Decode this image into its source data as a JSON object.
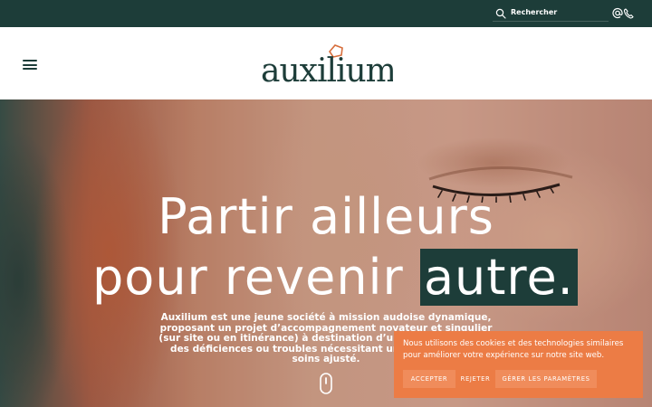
{
  "topbar": {
    "search_label": "Rechercher",
    "icons": [
      "search-icon",
      "at-icon",
      "phone-icon"
    ]
  },
  "header": {
    "logo_text": "auxilium",
    "icons": [
      "menu-icon"
    ]
  },
  "hero": {
    "headline_line1": "Partir ailleurs",
    "headline_line2_prefix": "pour revenir",
    "headline_line2_highlight": "autre.",
    "intro": "Auxilium est une jeune société à mission audoise dynamique, proposant un projet d’accompagnement novateur et singulier (sur site ou en itinérance) à destination d’une personne ayant des déficiences ou troubles nécessitant un programme de soins ajusté.",
    "scroll_icon": "mouse-scroll-icon"
  },
  "cookie_banner": {
    "text": "Nous utilisons des cookies et des technologies similaires pour améliorer votre expérience sur notre site web.",
    "accept_label": "ACCEPTER",
    "reject_label": "REJETER",
    "settings_label": "GÉRER LES PARAMÈTRES"
  },
  "colors": {
    "brand_dark": "#1d3d39",
    "logo_accent": "#d76e3c",
    "cookie_bg": "#ec7c45",
    "cookie_button": "#f08c5b",
    "text_light": "#ffffff"
  }
}
